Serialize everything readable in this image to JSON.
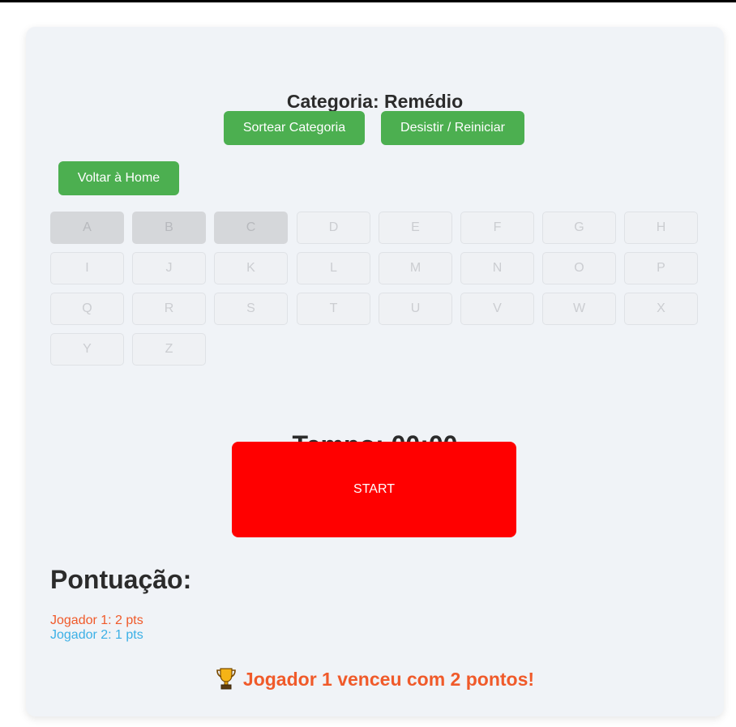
{
  "header": {
    "category_title": "Categoria: Remédio"
  },
  "controls": {
    "draw_category_label": "Sortear Categoria",
    "give_up_label": "Desistir / Reiniciar",
    "home_label": "Voltar à Home"
  },
  "letters": [
    {
      "label": "A",
      "used": true
    },
    {
      "label": "B",
      "used": true
    },
    {
      "label": "C",
      "used": true
    },
    {
      "label": "D",
      "used": false
    },
    {
      "label": "E",
      "used": false
    },
    {
      "label": "F",
      "used": false
    },
    {
      "label": "G",
      "used": false
    },
    {
      "label": "H",
      "used": false
    },
    {
      "label": "I",
      "used": false
    },
    {
      "label": "J",
      "used": false
    },
    {
      "label": "K",
      "used": false
    },
    {
      "label": "L",
      "used": false
    },
    {
      "label": "M",
      "used": false
    },
    {
      "label": "N",
      "used": false
    },
    {
      "label": "O",
      "used": false
    },
    {
      "label": "P",
      "used": false
    },
    {
      "label": "Q",
      "used": false
    },
    {
      "label": "R",
      "used": false
    },
    {
      "label": "S",
      "used": false
    },
    {
      "label": "T",
      "used": false
    },
    {
      "label": "U",
      "used": false
    },
    {
      "label": "V",
      "used": false
    },
    {
      "label": "W",
      "used": false
    },
    {
      "label": "X",
      "used": false
    },
    {
      "label": "Y",
      "used": false
    },
    {
      "label": "Z",
      "used": false
    }
  ],
  "timer": {
    "text": "Tempo: 00:00"
  },
  "start": {
    "label": "START"
  },
  "score": {
    "heading": "Pontuação:",
    "players": [
      {
        "text": "Jogador 1: 2 pts",
        "color": "#f05a2a"
      },
      {
        "text": "Jogador 2: 1 pts",
        "color": "#3cb0e6"
      }
    ]
  },
  "result": {
    "icon": "trophy-icon",
    "text": "Jogador 1 venceu com 2 pontos!"
  },
  "colors": {
    "accent_green": "#4caf50",
    "start_red": "#ff0000",
    "card_bg": "#f0f3f7"
  }
}
